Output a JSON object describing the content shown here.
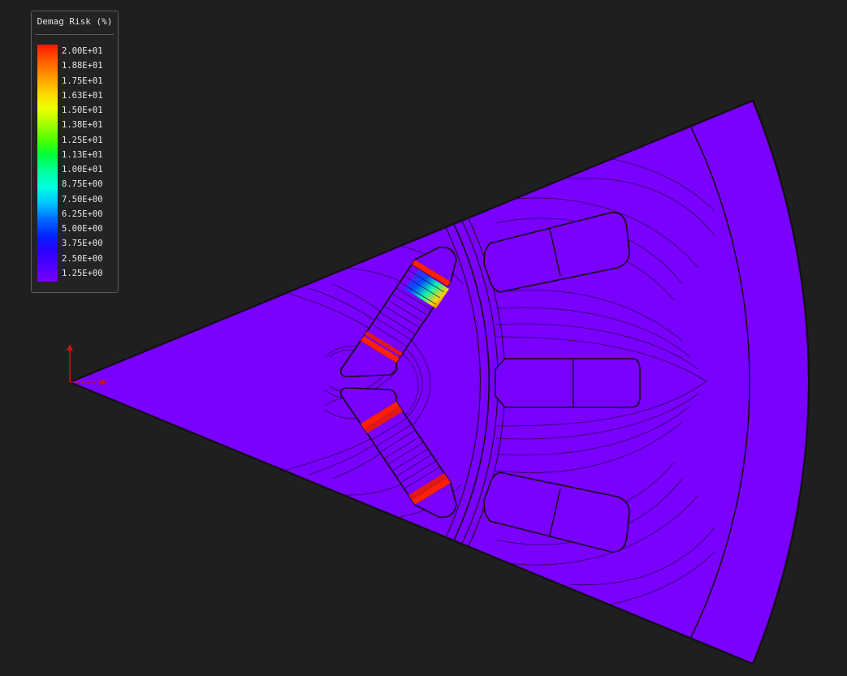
{
  "legend": {
    "title": "Demag Risk (%)",
    "ticks": [
      "2.00E+01",
      "1.88E+01",
      "1.75E+01",
      "1.63E+01",
      "1.50E+01",
      "1.38E+01",
      "1.25E+01",
      "1.13E+01",
      "1.00E+01",
      "8.75E+00",
      "7.50E+00",
      "6.25E+00",
      "5.00E+00",
      "3.75E+00",
      "2.50E+00",
      "1.25E+00"
    ],
    "colors_top_to_bottom": [
      "#ff1a00",
      "#ff5a00",
      "#ff9600",
      "#ffd200",
      "#f0ff00",
      "#a8ff00",
      "#50ff00",
      "#00ff38",
      "#00ff9c",
      "#00ffe0",
      "#00c8ff",
      "#0070ff",
      "#0028ff",
      "#2a00ff",
      "#5000ff",
      "#7a00ff"
    ]
  },
  "colors": {
    "background": "#1f1f1f",
    "domain_fill": "#7a00ff",
    "outline": "#111111",
    "flux_lines": "#2a0a55",
    "axis": "#d01010"
  },
  "icons": {
    "axis": "axis-triad-icon"
  }
}
